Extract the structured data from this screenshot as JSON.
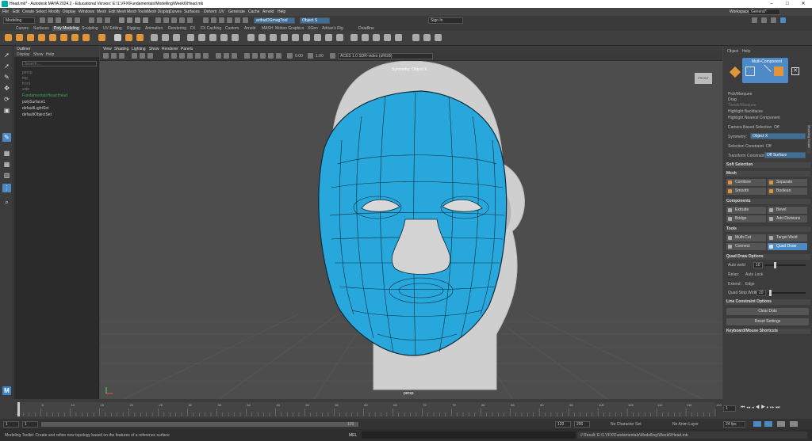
{
  "titlebar": {
    "title": "Head.mb* - Autodesk MAYA 2024.2 - Educational Version: E:\\1.VFX\\Fundamentals\\Modelling\\Week6\\Head.mb"
  },
  "menubar": {
    "items": [
      "File",
      "Edit",
      "Create",
      "Select",
      "Modify",
      "Display",
      "Windows",
      "Mesh",
      "Edit Mesh",
      "Mesh Tools",
      "Mesh Display",
      "Curves",
      "Surfaces",
      "Deform",
      "UV",
      "Generate",
      "Cache",
      "Arnold",
      "Help"
    ],
    "workspace_label": "Workspace:",
    "workspace_value": "General*"
  },
  "statusline": {
    "menuset": "Modeling",
    "symmetry_field": "arthurDGmagTool",
    "object_field": "Object S",
    "signin": "Sign In"
  },
  "shelf": {
    "tabs": [
      "Curves",
      "Surfaces",
      "Poly Modeling",
      "Sculpting",
      "UV Editing",
      "Rigging",
      "Animation",
      "Rendering",
      "FX",
      "FX Caching",
      "Custom",
      "Arnold",
      "MASH",
      "Motion Graphics",
      "XGen",
      "Adrian's Rig",
      "Deadline"
    ],
    "active_tab": "Poly Modeling"
  },
  "outliner": {
    "title": "Outliner",
    "menu": [
      "Display",
      "Show",
      "Help"
    ],
    "search_placeholder": "Search...",
    "items": [
      "persp",
      "top",
      "front",
      "side",
      "FundamentalsHead:Head",
      "polySurface1",
      "defaultLightSet",
      "defaultObjectSet"
    ]
  },
  "viewport": {
    "menu": [
      "View",
      "Shading",
      "Lighting",
      "Show",
      "Renderer",
      "Panels"
    ],
    "exposure": "0.00",
    "gamma": "1.00",
    "colorspace": "ACES 1.0 SDR-video (sRGB)",
    "symmetry_label": "Symmetry: Object X",
    "camera_label": "persp",
    "viewcube_label": "FRONT"
  },
  "modeling_toolkit": {
    "menu": [
      "Object",
      "Help"
    ],
    "mode_label": "Multi-Component",
    "selection_options": [
      {
        "label": "Pick/Marquee",
        "checked": true
      },
      {
        "label": "Drag",
        "checked": false
      },
      {
        "label": "Tweak/Marquee",
        "checked": false
      },
      {
        "label": "Highlight Backfaces",
        "checked": true
      },
      {
        "label": "Highlight Nearest Component",
        "checked": true
      }
    ],
    "camera_based_selection": "Camera Based Selection",
    "camera_based_value": "Off",
    "symmetry_label": "Symmetry:",
    "symmetry_value": "Object X",
    "selection_constraint_label": "Selection Constraint:",
    "selection_constraint_value": "Off",
    "transform_constraint_label": "Transform Constraint:",
    "transform_constraint_value": "Off Surface",
    "sections": {
      "soft_selection": "Soft Selection",
      "mesh": "Mesh",
      "components": "Components",
      "tools": "Tools",
      "quad_draw_options": "Quad Draw Options",
      "line_constraint": "Line Constraint Options",
      "shortcuts": "Keyboard/Mouse Shortcuts"
    },
    "mesh_buttons": [
      "Combine",
      "Separate",
      "Smooth",
      "Boolean"
    ],
    "component_buttons": [
      "Extrude",
      "Bevel",
      "Bridge",
      "Add Divisions"
    ],
    "tool_buttons": [
      "Multi-Cut",
      "Target Weld",
      "Connect",
      "Quad Draw"
    ],
    "active_tool": "Quad Draw",
    "auto_weld_label": "Auto weld",
    "auto_weld_value": "10",
    "relax_label": "Relax:",
    "relax_value": "Auto Lock",
    "extend_label": "Extend:",
    "extend_value": "Edge",
    "strip_label": "Quad Strip Width:",
    "strip_value": "20",
    "clear_dots": "Clear Dots",
    "reset_settings": "Reset Settings",
    "side_tab": "Modeling Toolkit"
  },
  "timeline": {
    "ticks": [
      "1",
      "5",
      "10",
      "15",
      "20",
      "25",
      "30",
      "35",
      "40",
      "45",
      "50",
      "55",
      "60",
      "65",
      "70",
      "75",
      "80",
      "85",
      "90",
      "95",
      "100",
      "105",
      "110",
      "115",
      "120"
    ],
    "current_frame": "1"
  },
  "range": {
    "start": "1",
    "start2": "1",
    "end_inner": "120",
    "end": "120",
    "end2": "200",
    "character_set": "No Character Set",
    "anim_layer": "No Anim Layer",
    "fps": "24 fps"
  },
  "cmdline": {
    "help": "Modeling Toolkit: Create and refine new topology based on the features of a reference surface",
    "lang": "MEL",
    "result": "// Result: E:\\1.VFX\\Fundamentals\\Modelling\\Week6\\Head.mb"
  },
  "colors": {
    "accent": "#4c89c5",
    "retopo": "#27a7dc",
    "shelf_orange": "#e0953a"
  }
}
